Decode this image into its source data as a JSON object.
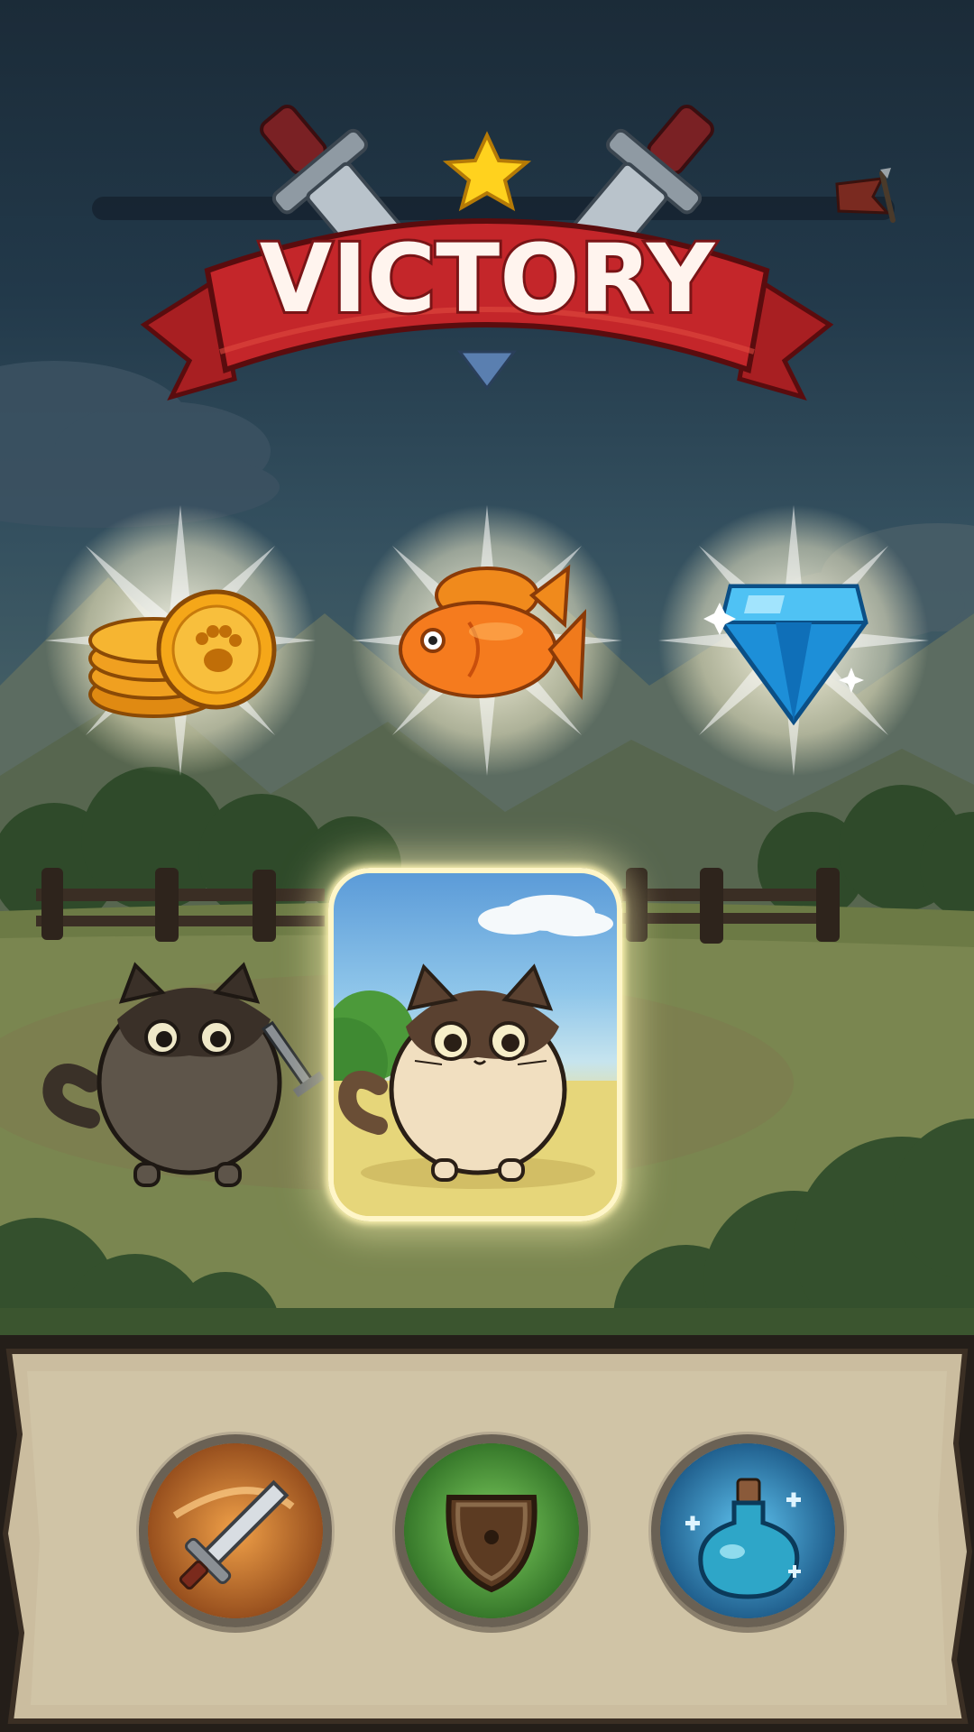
{
  "banner": {
    "title": "VICTORY"
  },
  "rewards": [
    {
      "name": "coins",
      "icon": "paw-coin-icon"
    },
    {
      "name": "fish",
      "icon": "fish-icon"
    },
    {
      "name": "gem",
      "icon": "blue-gem-icon"
    }
  ],
  "skills": [
    {
      "name": "attack",
      "icon": "sword-icon",
      "color": "#c8641e"
    },
    {
      "name": "defense",
      "icon": "shield-icon",
      "color": "#3f9a2c"
    },
    {
      "name": "heal",
      "icon": "potion-icon",
      "color": "#1f7fb6"
    }
  ],
  "colors": {
    "banner_red": "#c4262a",
    "banner_text": "#fff4ee",
    "panel_parchment": "#cfc2a6",
    "card_glow": "#fff3b0"
  }
}
